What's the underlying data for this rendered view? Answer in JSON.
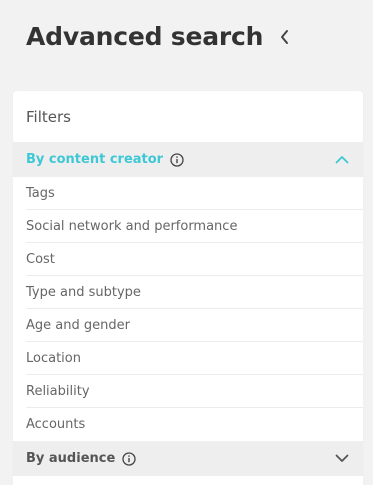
{
  "header": {
    "title": "Advanced search",
    "collapse_icon": "chevron-left-icon"
  },
  "filters": {
    "title": "Filters",
    "sections": [
      {
        "label": "By content creator",
        "info_icon": "info-icon",
        "expanded": true,
        "chevron_icon": "chevron-up-icon",
        "accent_color": "#3ec8d6",
        "items": [
          "Tags",
          "Social network and performance",
          "Cost",
          "Type and subtype",
          "Age and gender",
          "Location",
          "Reliability",
          "Accounts"
        ]
      },
      {
        "label": "By audience",
        "info_icon": "info-icon",
        "expanded": false,
        "chevron_icon": "chevron-down-icon"
      }
    ]
  }
}
